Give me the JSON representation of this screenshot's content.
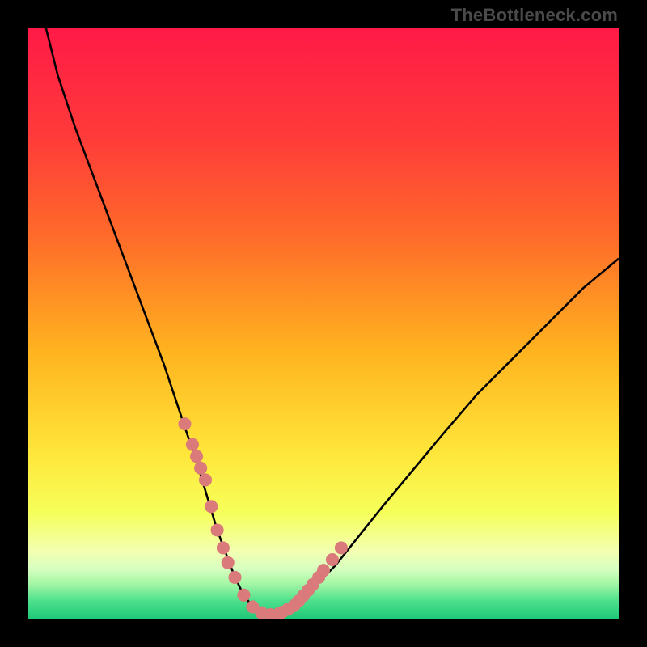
{
  "watermark": "TheBottleneck.com",
  "colors": {
    "frame": "#000000",
    "curve_stroke": "#000000",
    "marker_fill": "#db7a7a",
    "gradient_stops": [
      {
        "offset": 0.0,
        "color": "#ff1a47"
      },
      {
        "offset": 0.18,
        "color": "#ff3a3a"
      },
      {
        "offset": 0.35,
        "color": "#ff6a2a"
      },
      {
        "offset": 0.55,
        "color": "#ffb41f"
      },
      {
        "offset": 0.72,
        "color": "#ffe63a"
      },
      {
        "offset": 0.82,
        "color": "#f6ff5a"
      },
      {
        "offset": 0.885,
        "color": "#f3ffb0"
      },
      {
        "offset": 0.915,
        "color": "#d8ffc0"
      },
      {
        "offset": 0.94,
        "color": "#a6f7a6"
      },
      {
        "offset": 0.97,
        "color": "#4de08c"
      },
      {
        "offset": 1.0,
        "color": "#1fc878"
      }
    ]
  },
  "chart_data": {
    "type": "line",
    "title": "",
    "xlabel": "",
    "ylabel": "",
    "xlim": [
      0,
      100
    ],
    "ylim": [
      0,
      100
    ],
    "grid": false,
    "legend": false,
    "series": [
      {
        "name": "bottleneck-curve",
        "x": [
          3,
          5,
          8,
          11,
          14,
          17,
          20,
          23,
          25,
          27,
          29,
          30.5,
          32,
          33.5,
          35,
          36.5,
          38,
          40,
          42,
          45,
          48,
          52,
          56,
          60,
          65,
          70,
          76,
          82,
          88,
          94,
          100
        ],
        "values": [
          100,
          92,
          83,
          75,
          67,
          59,
          51,
          43,
          37,
          31,
          25,
          20,
          15,
          11,
          7,
          4,
          2,
          0.5,
          0.5,
          2,
          5,
          9,
          14,
          19,
          25,
          31,
          38,
          44,
          50,
          56,
          61
        ]
      }
    ],
    "markers": {
      "name": "highlighted-points",
      "shape": "circle",
      "radius_px": 8,
      "x": [
        26.5,
        27.8,
        28.5,
        29.2,
        30,
        31,
        32,
        33,
        33.8,
        35,
        36.5,
        38,
        39.5,
        41,
        42.5,
        43,
        44,
        45,
        45.8,
        46.6,
        47.4,
        48.2,
        49.2,
        50,
        51.5,
        53
      ],
      "values": [
        33,
        29.5,
        27.5,
        25.5,
        23.5,
        19,
        15,
        12,
        9.5,
        7,
        4,
        2,
        1,
        0.7,
        0.9,
        1.1,
        1.6,
        2.2,
        3,
        3.9,
        4.8,
        5.8,
        7,
        8.2,
        10,
        12
      ]
    }
  }
}
